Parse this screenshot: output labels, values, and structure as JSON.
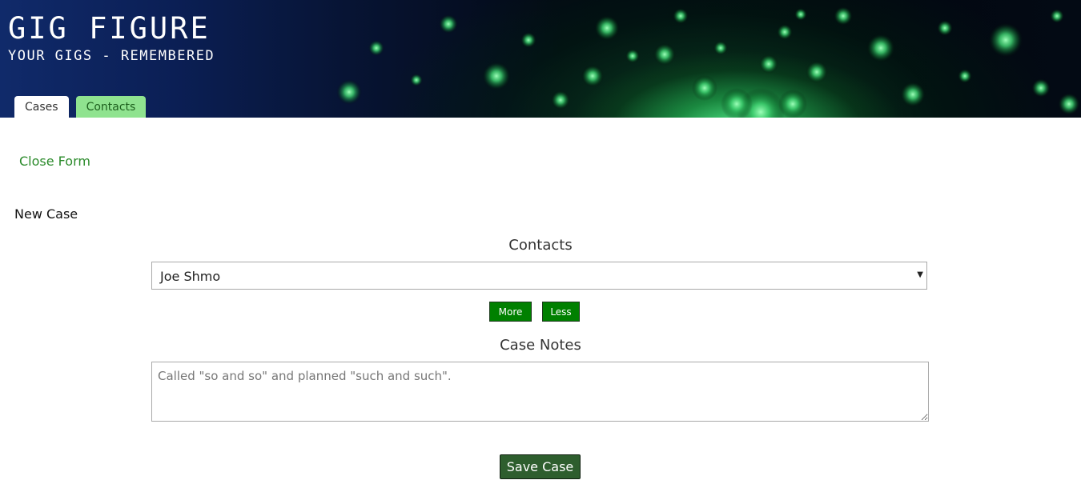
{
  "header": {
    "title": "GIG FIGURE",
    "subtitle": "YOUR GIGS - REMEMBERED",
    "tabs": [
      {
        "label": "Cases",
        "active": true
      },
      {
        "label": "Contacts",
        "active": false
      }
    ]
  },
  "form": {
    "close_link": "Close Form",
    "section_title": "New Case",
    "contacts_label": "Contacts",
    "contacts_selected": "Joe Shmo",
    "more_button": "More",
    "less_button": "Less",
    "notes_label": "Case Notes",
    "notes_placeholder": "Called \"so and so\" and planned \"such and such\".",
    "save_button": "Save Case"
  },
  "colors": {
    "accent_green": "#008000",
    "tab_inactive": "#8fe38f",
    "link_green": "#2a8a2a",
    "save_button_bg": "#2e5e2e"
  },
  "icons": {
    "select_arrow": "dropdown-arrow-icon"
  }
}
